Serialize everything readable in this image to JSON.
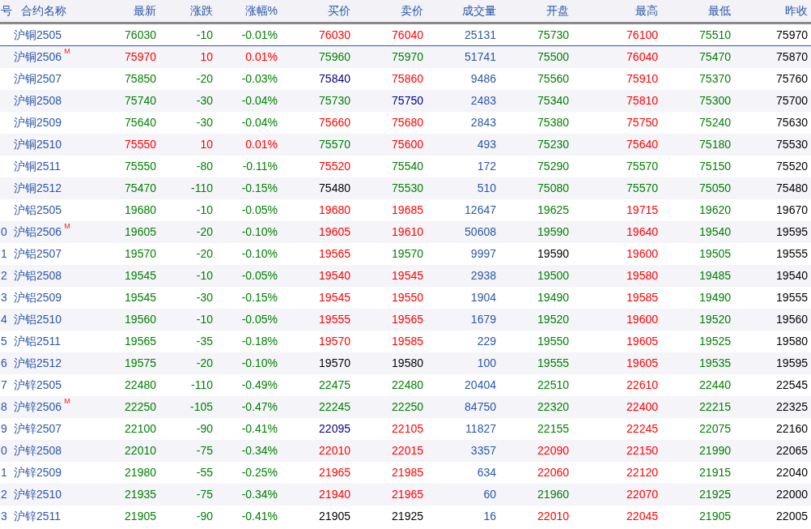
{
  "table": {
    "columns": [
      "号",
      "合约名称",
      "最新",
      "涨跌",
      "涨幅%",
      "买价",
      "卖价",
      "成交量",
      "开盘",
      "最高",
      "最低",
      "昨收"
    ],
    "rows": [
      {
        "selected": true,
        "cells": [
          {
            "text": ""
          },
          {
            "text": "沪铜2505"
          },
          {
            "text": "76030",
            "color": "#008000"
          },
          {
            "text": "-10",
            "color": "#008000"
          },
          {
            "text": "-0.01%",
            "color": "#008000"
          },
          {
            "text": "76030",
            "color": "#ff0000"
          },
          {
            "text": "76040",
            "color": "#ff0000"
          },
          {
            "text": "25131",
            "color": "#2b57a8"
          },
          {
            "text": "75730",
            "color": "#008000"
          },
          {
            "text": "76100",
            "color": "#ff0000"
          },
          {
            "text": "75510",
            "color": "#008000"
          },
          {
            "text": "75970",
            "color": "#000000"
          }
        ]
      },
      {
        "selected": false,
        "cells": [
          {
            "text": ""
          },
          {
            "text": "沪铜2506",
            "badge": "M"
          },
          {
            "text": "75970",
            "color": "#ff0000"
          },
          {
            "text": "10",
            "color": "#ff0000"
          },
          {
            "text": "0.01%",
            "color": "#ff0000"
          },
          {
            "text": "75960",
            "color": "#008000"
          },
          {
            "text": "75970",
            "color": "#008000"
          },
          {
            "text": "51741",
            "color": "#2b57a8"
          },
          {
            "text": "75500",
            "color": "#008000"
          },
          {
            "text": "76040",
            "color": "#ff0000"
          },
          {
            "text": "75470",
            "color": "#008000"
          },
          {
            "text": "75870",
            "color": "#000000"
          }
        ]
      },
      {
        "selected": false,
        "cells": [
          {
            "text": ""
          },
          {
            "text": "沪铜2507"
          },
          {
            "text": "75850",
            "color": "#008000"
          },
          {
            "text": "-20",
            "color": "#008000"
          },
          {
            "text": "-0.03%",
            "color": "#008000"
          },
          {
            "text": "75840",
            "color": "#000080"
          },
          {
            "text": "75860",
            "color": "#ff0000"
          },
          {
            "text": "9486",
            "color": "#2b57a8"
          },
          {
            "text": "75560",
            "color": "#008000"
          },
          {
            "text": "75910",
            "color": "#ff0000"
          },
          {
            "text": "75370",
            "color": "#008000"
          },
          {
            "text": "75760",
            "color": "#000000"
          }
        ]
      },
      {
        "selected": false,
        "cells": [
          {
            "text": ""
          },
          {
            "text": "沪铜2508"
          },
          {
            "text": "75740",
            "color": "#008000"
          },
          {
            "text": "-30",
            "color": "#008000"
          },
          {
            "text": "-0.04%",
            "color": "#008000"
          },
          {
            "text": "75730",
            "color": "#008000"
          },
          {
            "text": "75750",
            "color": "#000080"
          },
          {
            "text": "2483",
            "color": "#2b57a8"
          },
          {
            "text": "75340",
            "color": "#008000"
          },
          {
            "text": "75810",
            "color": "#ff0000"
          },
          {
            "text": "75300",
            "color": "#008000"
          },
          {
            "text": "75700",
            "color": "#000000"
          }
        ]
      },
      {
        "selected": false,
        "cells": [
          {
            "text": ""
          },
          {
            "text": "沪铜2509"
          },
          {
            "text": "75640",
            "color": "#008000"
          },
          {
            "text": "-30",
            "color": "#008000"
          },
          {
            "text": "-0.04%",
            "color": "#008000"
          },
          {
            "text": "75660",
            "color": "#ff0000"
          },
          {
            "text": "75680",
            "color": "#ff0000"
          },
          {
            "text": "2843",
            "color": "#2b57a8"
          },
          {
            "text": "75380",
            "color": "#008000"
          },
          {
            "text": "75750",
            "color": "#ff0000"
          },
          {
            "text": "75240",
            "color": "#008000"
          },
          {
            "text": "75630",
            "color": "#000000"
          }
        ]
      },
      {
        "selected": false,
        "cells": [
          {
            "text": ""
          },
          {
            "text": "沪铜2510"
          },
          {
            "text": "75550",
            "color": "#ff0000"
          },
          {
            "text": "10",
            "color": "#ff0000"
          },
          {
            "text": "0.01%",
            "color": "#ff0000"
          },
          {
            "text": "75570",
            "color": "#008000"
          },
          {
            "text": "75600",
            "color": "#ff0000"
          },
          {
            "text": "493",
            "color": "#2b57a8"
          },
          {
            "text": "75230",
            "color": "#008000"
          },
          {
            "text": "75640",
            "color": "#ff0000"
          },
          {
            "text": "75180",
            "color": "#008000"
          },
          {
            "text": "75530",
            "color": "#000000"
          }
        ]
      },
      {
        "selected": false,
        "cells": [
          {
            "text": ""
          },
          {
            "text": "沪铜2511"
          },
          {
            "text": "75550",
            "color": "#008000"
          },
          {
            "text": "-80",
            "color": "#008000"
          },
          {
            "text": "-0.11%",
            "color": "#008000"
          },
          {
            "text": "75520",
            "color": "#ff0000"
          },
          {
            "text": "75540",
            "color": "#008000"
          },
          {
            "text": "172",
            "color": "#2b57a8"
          },
          {
            "text": "75290",
            "color": "#008000"
          },
          {
            "text": "75570",
            "color": "#008000"
          },
          {
            "text": "75150",
            "color": "#008000"
          },
          {
            "text": "75520",
            "color": "#000000"
          }
        ]
      },
      {
        "selected": false,
        "cells": [
          {
            "text": ""
          },
          {
            "text": "沪铜2512"
          },
          {
            "text": "75470",
            "color": "#008000"
          },
          {
            "text": "-110",
            "color": "#008000"
          },
          {
            "text": "-0.15%",
            "color": "#008000"
          },
          {
            "text": "75480",
            "color": "#000000"
          },
          {
            "text": "75530",
            "color": "#008000"
          },
          {
            "text": "510",
            "color": "#2b57a8"
          },
          {
            "text": "75080",
            "color": "#008000"
          },
          {
            "text": "75570",
            "color": "#008000"
          },
          {
            "text": "75050",
            "color": "#008000"
          },
          {
            "text": "75480",
            "color": "#000000"
          }
        ]
      },
      {
        "selected": false,
        "cells": [
          {
            "text": ""
          },
          {
            "text": "沪铝2505"
          },
          {
            "text": "19680",
            "color": "#008000"
          },
          {
            "text": "-10",
            "color": "#008000"
          },
          {
            "text": "-0.05%",
            "color": "#008000"
          },
          {
            "text": "19680",
            "color": "#ff0000"
          },
          {
            "text": "19685",
            "color": "#ff0000"
          },
          {
            "text": "12647",
            "color": "#2b57a8"
          },
          {
            "text": "19625",
            "color": "#008000"
          },
          {
            "text": "19715",
            "color": "#ff0000"
          },
          {
            "text": "19620",
            "color": "#008000"
          },
          {
            "text": "19670",
            "color": "#000000"
          }
        ]
      },
      {
        "selected": false,
        "cells": [
          {
            "text": "0"
          },
          {
            "text": "沪铝2506",
            "badge": "M"
          },
          {
            "text": "19605",
            "color": "#008000"
          },
          {
            "text": "-20",
            "color": "#008000"
          },
          {
            "text": "-0.10%",
            "color": "#008000"
          },
          {
            "text": "19605",
            "color": "#ff0000"
          },
          {
            "text": "19610",
            "color": "#ff0000"
          },
          {
            "text": "50608",
            "color": "#2b57a8"
          },
          {
            "text": "19590",
            "color": "#008000"
          },
          {
            "text": "19640",
            "color": "#ff0000"
          },
          {
            "text": "19540",
            "color": "#008000"
          },
          {
            "text": "19595",
            "color": "#000000"
          }
        ]
      },
      {
        "selected": false,
        "cells": [
          {
            "text": "1"
          },
          {
            "text": "沪铝2507"
          },
          {
            "text": "19570",
            "color": "#008000"
          },
          {
            "text": "-20",
            "color": "#008000"
          },
          {
            "text": "-0.10%",
            "color": "#008000"
          },
          {
            "text": "19565",
            "color": "#ff0000"
          },
          {
            "text": "19570",
            "color": "#008000"
          },
          {
            "text": "9997",
            "color": "#2b57a8"
          },
          {
            "text": "19590",
            "color": "#000000"
          },
          {
            "text": "19600",
            "color": "#ff0000"
          },
          {
            "text": "19505",
            "color": "#008000"
          },
          {
            "text": "19555",
            "color": "#000000"
          }
        ]
      },
      {
        "selected": false,
        "cells": [
          {
            "text": "2"
          },
          {
            "text": "沪铝2508"
          },
          {
            "text": "19545",
            "color": "#008000"
          },
          {
            "text": "-10",
            "color": "#008000"
          },
          {
            "text": "-0.05%",
            "color": "#008000"
          },
          {
            "text": "19540",
            "color": "#ff0000"
          },
          {
            "text": "19545",
            "color": "#ff0000"
          },
          {
            "text": "2938",
            "color": "#2b57a8"
          },
          {
            "text": "19500",
            "color": "#008000"
          },
          {
            "text": "19580",
            "color": "#ff0000"
          },
          {
            "text": "19485",
            "color": "#008000"
          },
          {
            "text": "19540",
            "color": "#000000"
          }
        ]
      },
      {
        "selected": false,
        "cells": [
          {
            "text": "3"
          },
          {
            "text": "沪铝2509"
          },
          {
            "text": "19545",
            "color": "#008000"
          },
          {
            "text": "-30",
            "color": "#008000"
          },
          {
            "text": "-0.15%",
            "color": "#008000"
          },
          {
            "text": "19545",
            "color": "#ff0000"
          },
          {
            "text": "19550",
            "color": "#ff0000"
          },
          {
            "text": "1904",
            "color": "#2b57a8"
          },
          {
            "text": "19490",
            "color": "#008000"
          },
          {
            "text": "19585",
            "color": "#ff0000"
          },
          {
            "text": "19490",
            "color": "#008000"
          },
          {
            "text": "19555",
            "color": "#000000"
          }
        ]
      },
      {
        "selected": false,
        "cells": [
          {
            "text": "4"
          },
          {
            "text": "沪铝2510"
          },
          {
            "text": "19560",
            "color": "#008000"
          },
          {
            "text": "-10",
            "color": "#008000"
          },
          {
            "text": "-0.05%",
            "color": "#008000"
          },
          {
            "text": "19555",
            "color": "#ff0000"
          },
          {
            "text": "19565",
            "color": "#ff0000"
          },
          {
            "text": "1679",
            "color": "#2b57a8"
          },
          {
            "text": "19520",
            "color": "#008000"
          },
          {
            "text": "19600",
            "color": "#ff0000"
          },
          {
            "text": "19520",
            "color": "#008000"
          },
          {
            "text": "19560",
            "color": "#000000"
          }
        ]
      },
      {
        "selected": false,
        "cells": [
          {
            "text": "5"
          },
          {
            "text": "沪铝2511"
          },
          {
            "text": "19565",
            "color": "#008000"
          },
          {
            "text": "-35",
            "color": "#008000"
          },
          {
            "text": "-0.18%",
            "color": "#008000"
          },
          {
            "text": "19570",
            "color": "#ff0000"
          },
          {
            "text": "19585",
            "color": "#ff0000"
          },
          {
            "text": "229",
            "color": "#2b57a8"
          },
          {
            "text": "19550",
            "color": "#008000"
          },
          {
            "text": "19605",
            "color": "#ff0000"
          },
          {
            "text": "19525",
            "color": "#008000"
          },
          {
            "text": "19580",
            "color": "#000000"
          }
        ]
      },
      {
        "selected": false,
        "cells": [
          {
            "text": "6"
          },
          {
            "text": "沪铝2512"
          },
          {
            "text": "19575",
            "color": "#008000"
          },
          {
            "text": "-20",
            "color": "#008000"
          },
          {
            "text": "-0.10%",
            "color": "#008000"
          },
          {
            "text": "19570",
            "color": "#000000"
          },
          {
            "text": "19580",
            "color": "#000000"
          },
          {
            "text": "100",
            "color": "#2b57a8"
          },
          {
            "text": "19555",
            "color": "#008000"
          },
          {
            "text": "19605",
            "color": "#ff0000"
          },
          {
            "text": "19535",
            "color": "#008000"
          },
          {
            "text": "19595",
            "color": "#000000"
          }
        ]
      },
      {
        "selected": false,
        "cells": [
          {
            "text": "7"
          },
          {
            "text": "沪锌2505"
          },
          {
            "text": "22480",
            "color": "#008000"
          },
          {
            "text": "-110",
            "color": "#008000"
          },
          {
            "text": "-0.49%",
            "color": "#008000"
          },
          {
            "text": "22475",
            "color": "#008000"
          },
          {
            "text": "22480",
            "color": "#008000"
          },
          {
            "text": "20404",
            "color": "#2b57a8"
          },
          {
            "text": "22510",
            "color": "#008000"
          },
          {
            "text": "22610",
            "color": "#ff0000"
          },
          {
            "text": "22440",
            "color": "#008000"
          },
          {
            "text": "22545",
            "color": "#000000"
          }
        ]
      },
      {
        "selected": false,
        "cells": [
          {
            "text": "8"
          },
          {
            "text": "沪锌2506",
            "badge": "M"
          },
          {
            "text": "22250",
            "color": "#008000"
          },
          {
            "text": "-105",
            "color": "#008000"
          },
          {
            "text": "-0.47%",
            "color": "#008000"
          },
          {
            "text": "22245",
            "color": "#008000"
          },
          {
            "text": "22250",
            "color": "#008000"
          },
          {
            "text": "84750",
            "color": "#2b57a8"
          },
          {
            "text": "22320",
            "color": "#008000"
          },
          {
            "text": "22400",
            "color": "#ff0000"
          },
          {
            "text": "22215",
            "color": "#008000"
          },
          {
            "text": "22325",
            "color": "#000000"
          }
        ]
      },
      {
        "selected": false,
        "cells": [
          {
            "text": "9"
          },
          {
            "text": "沪锌2507"
          },
          {
            "text": "22100",
            "color": "#008000"
          },
          {
            "text": "-90",
            "color": "#008000"
          },
          {
            "text": "-0.41%",
            "color": "#008000"
          },
          {
            "text": "22095",
            "color": "#000080"
          },
          {
            "text": "22105",
            "color": "#ff0000"
          },
          {
            "text": "11827",
            "color": "#2b57a8"
          },
          {
            "text": "22155",
            "color": "#008000"
          },
          {
            "text": "22245",
            "color": "#ff0000"
          },
          {
            "text": "22075",
            "color": "#008000"
          },
          {
            "text": "22160",
            "color": "#000000"
          }
        ]
      },
      {
        "selected": false,
        "cells": [
          {
            "text": "0"
          },
          {
            "text": "沪锌2508"
          },
          {
            "text": "22010",
            "color": "#008000"
          },
          {
            "text": "-75",
            "color": "#008000"
          },
          {
            "text": "-0.34%",
            "color": "#008000"
          },
          {
            "text": "22010",
            "color": "#ff0000"
          },
          {
            "text": "22015",
            "color": "#ff0000"
          },
          {
            "text": "3357",
            "color": "#2b57a8"
          },
          {
            "text": "22090",
            "color": "#ff0000"
          },
          {
            "text": "22150",
            "color": "#ff0000"
          },
          {
            "text": "21990",
            "color": "#008000"
          },
          {
            "text": "22065",
            "color": "#000000"
          }
        ]
      },
      {
        "selected": false,
        "cells": [
          {
            "text": "1"
          },
          {
            "text": "沪锌2509"
          },
          {
            "text": "21980",
            "color": "#008000"
          },
          {
            "text": "-55",
            "color": "#008000"
          },
          {
            "text": "-0.25%",
            "color": "#008000"
          },
          {
            "text": "21965",
            "color": "#ff0000"
          },
          {
            "text": "21985",
            "color": "#ff0000"
          },
          {
            "text": "634",
            "color": "#2b57a8"
          },
          {
            "text": "22060",
            "color": "#ff0000"
          },
          {
            "text": "22120",
            "color": "#ff0000"
          },
          {
            "text": "21915",
            "color": "#008000"
          },
          {
            "text": "22040",
            "color": "#000000"
          }
        ]
      },
      {
        "selected": false,
        "cells": [
          {
            "text": "2"
          },
          {
            "text": "沪锌2510"
          },
          {
            "text": "21935",
            "color": "#008000"
          },
          {
            "text": "-75",
            "color": "#008000"
          },
          {
            "text": "-0.34%",
            "color": "#008000"
          },
          {
            "text": "21940",
            "color": "#ff0000"
          },
          {
            "text": "21965",
            "color": "#ff0000"
          },
          {
            "text": "60",
            "color": "#2b57a8"
          },
          {
            "text": "21960",
            "color": "#008000"
          },
          {
            "text": "22070",
            "color": "#ff0000"
          },
          {
            "text": "21925",
            "color": "#008000"
          },
          {
            "text": "22000",
            "color": "#000000"
          }
        ]
      },
      {
        "selected": false,
        "cells": [
          {
            "text": "3"
          },
          {
            "text": "沪锌2511"
          },
          {
            "text": "21905",
            "color": "#008000"
          },
          {
            "text": "-90",
            "color": "#008000"
          },
          {
            "text": "-0.41%",
            "color": "#008000"
          },
          {
            "text": "21905",
            "color": "#000000"
          },
          {
            "text": "21925",
            "color": "#000000"
          },
          {
            "text": "16",
            "color": "#2b57a8"
          },
          {
            "text": "22010",
            "color": "#ff0000"
          },
          {
            "text": "22045",
            "color": "#ff0000"
          },
          {
            "text": "21905",
            "color": "#008000"
          },
          {
            "text": "22005",
            "color": "#000000"
          }
        ]
      }
    ]
  }
}
